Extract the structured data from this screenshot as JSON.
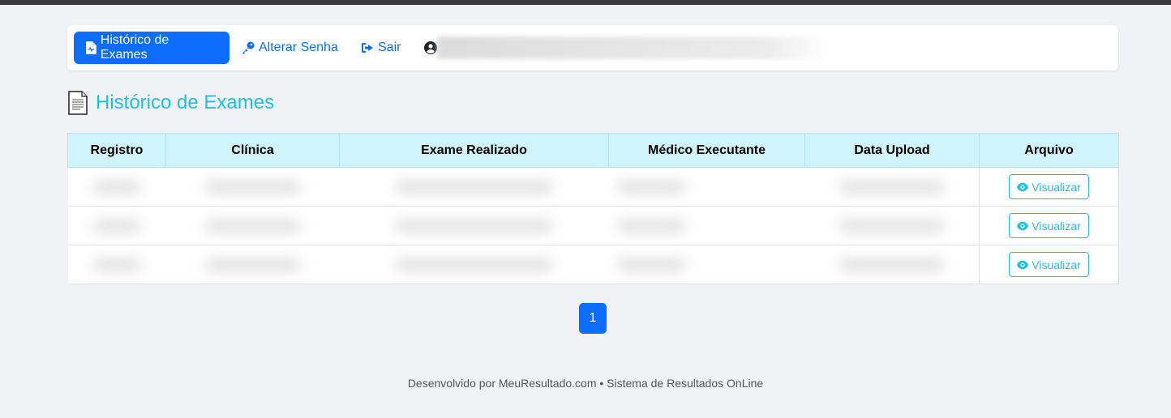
{
  "nav": {
    "items": [
      {
        "label": "Histórico de Exames",
        "icon": "file-medical-icon",
        "active": true
      },
      {
        "label": "Alterar Senha",
        "icon": "key-icon",
        "active": false
      },
      {
        "label": "Sair",
        "icon": "sign-out-icon",
        "active": false
      }
    ],
    "user_icon": "user-circle-icon"
  },
  "page": {
    "title": "Histórico de Exames",
    "title_icon": "document-icon"
  },
  "table": {
    "columns": [
      "Registro",
      "Clínica",
      "Exame Realizado",
      "Médico Executante",
      "Data Upload",
      "Arquivo"
    ],
    "rows": [
      {
        "action_label": "Visualizar"
      },
      {
        "action_label": "Visualizar"
      },
      {
        "action_label": "Visualizar"
      }
    ]
  },
  "pagination": {
    "current": "1"
  },
  "footer": {
    "text": "Desenvolvido por MeuResultado.com • Sistema de Resultados OnLine"
  },
  "colors": {
    "primary": "#0d6efd",
    "info": "#1ec0e0",
    "header_bg": "#cff4fc",
    "page_bg": "#f0f2f5"
  }
}
